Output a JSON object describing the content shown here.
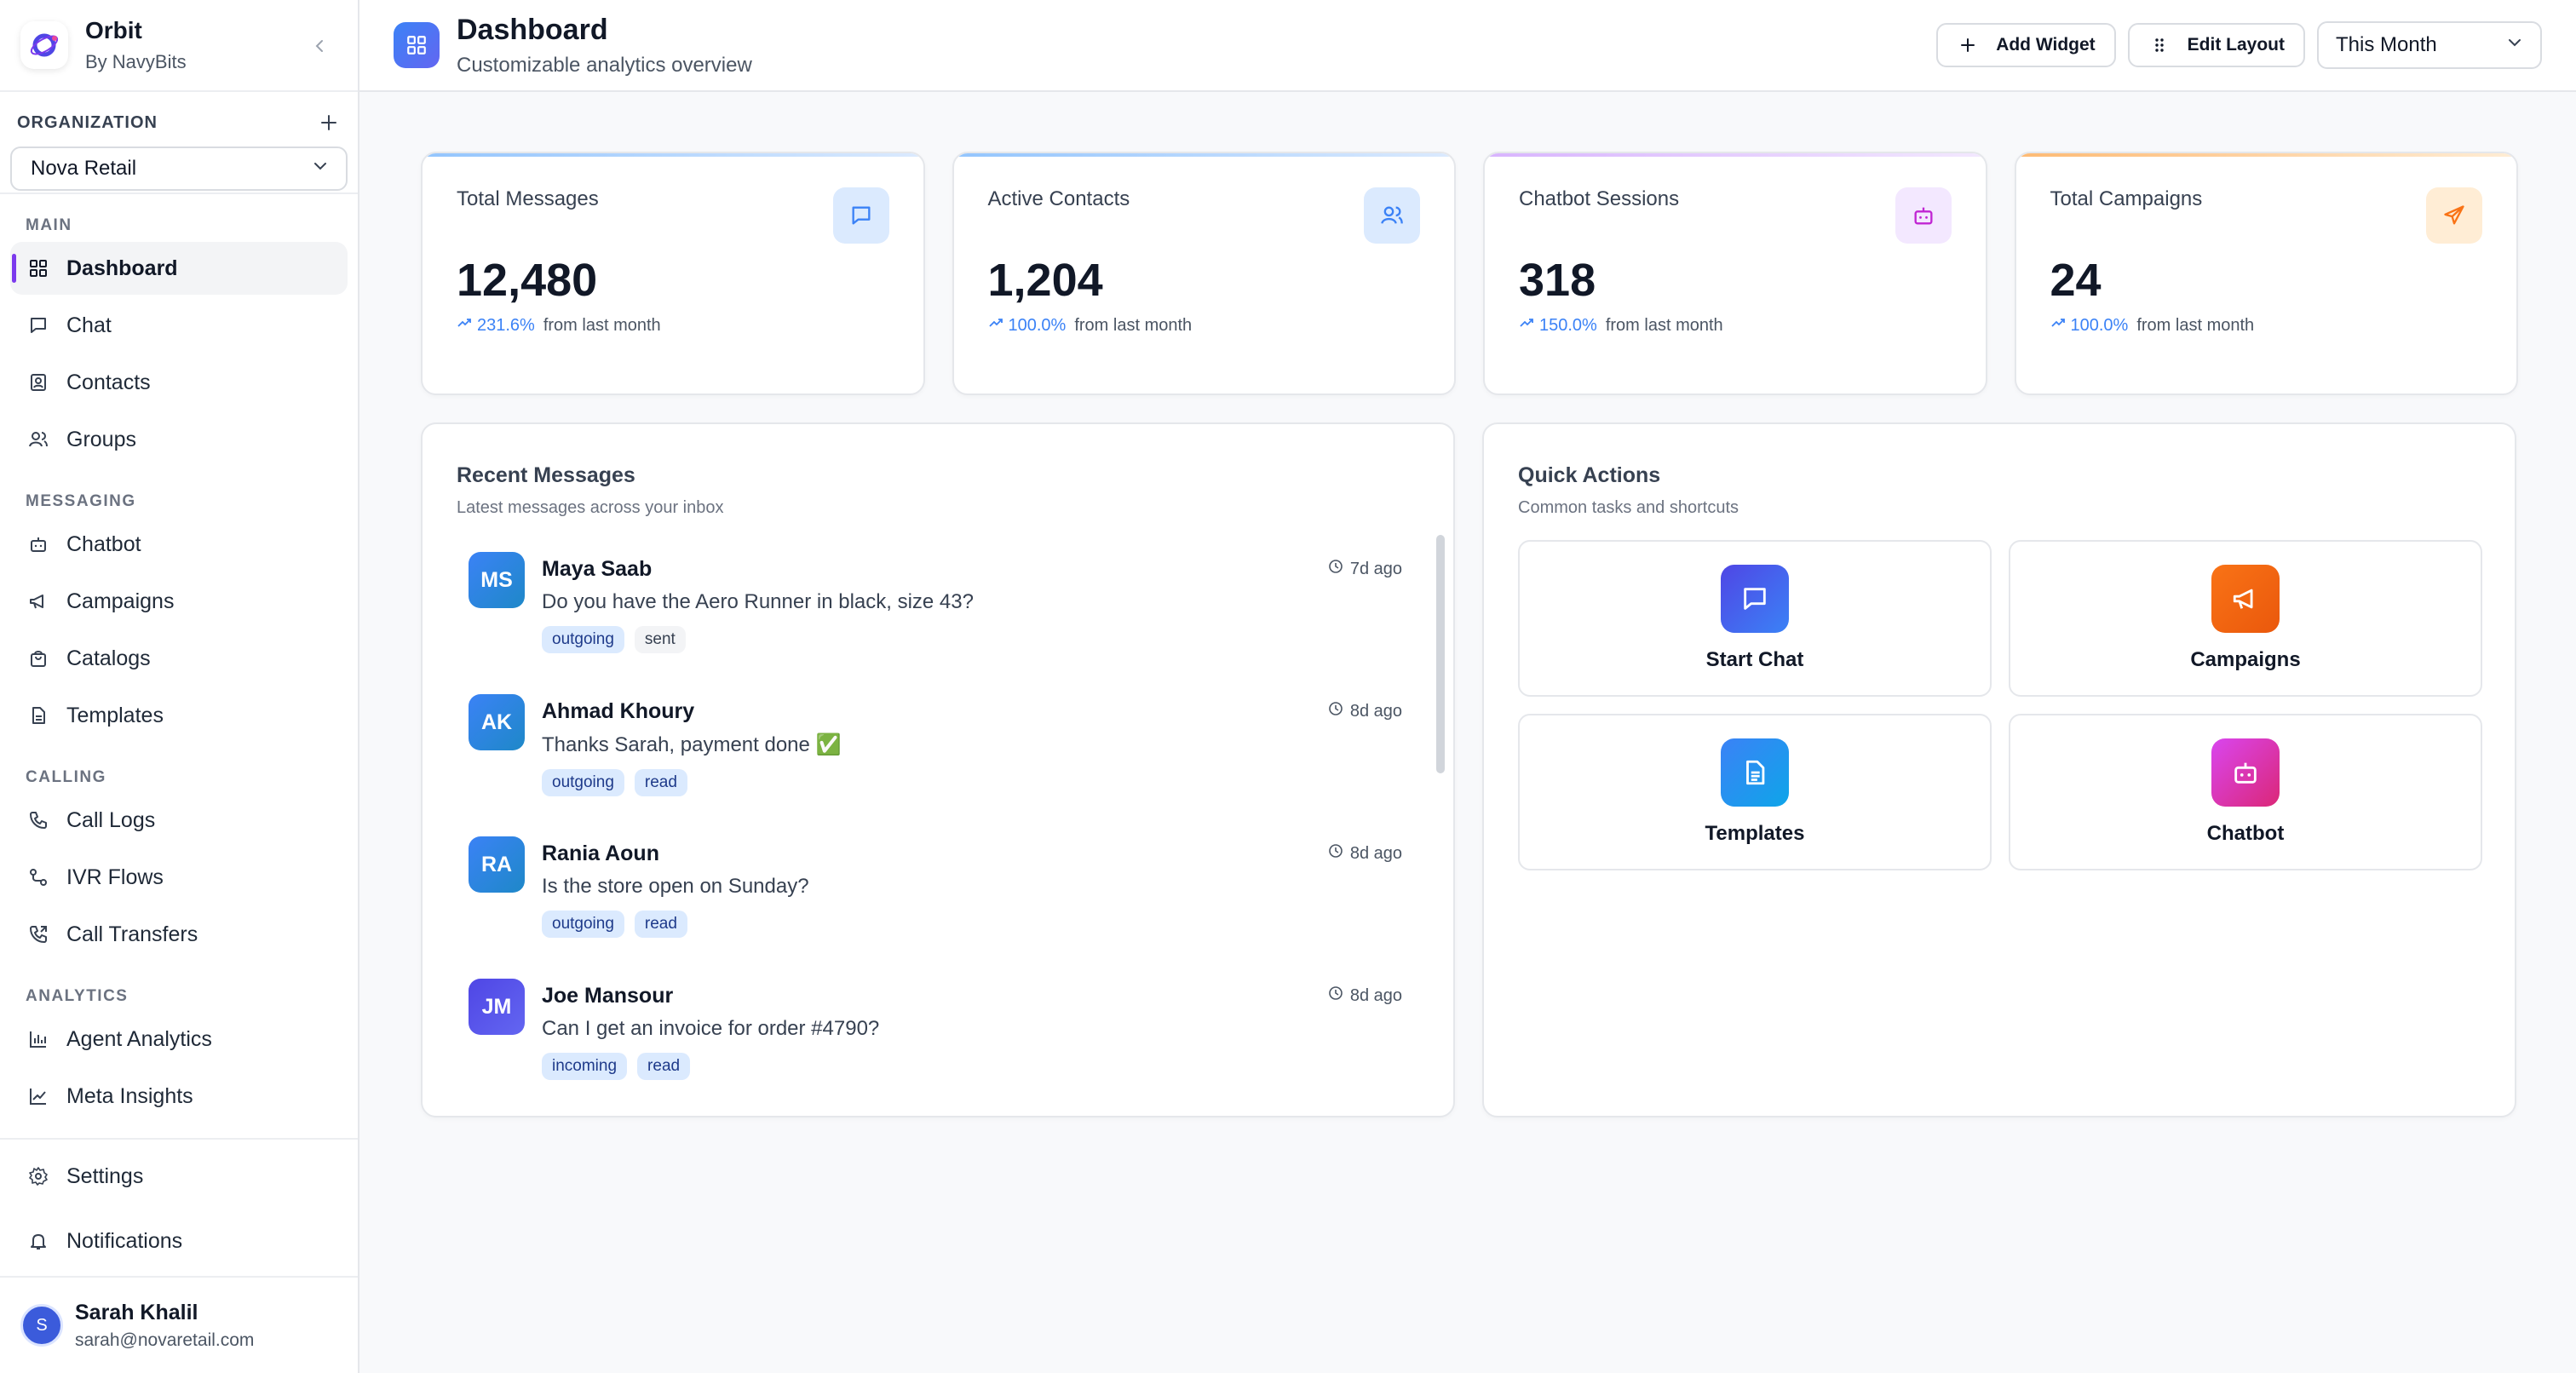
{
  "brand": {
    "name": "Orbit",
    "sub": "By NavyBits"
  },
  "organization": {
    "label": "ORGANIZATION",
    "selected": "Nova Retail"
  },
  "nav": {
    "main_label": "MAIN",
    "dashboard": "Dashboard",
    "chat": "Chat",
    "contacts": "Contacts",
    "groups": "Groups",
    "messaging_label": "MESSAGING",
    "chatbot": "Chatbot",
    "campaigns": "Campaigns",
    "catalogs": "Catalogs",
    "templates": "Templates",
    "calling_label": "CALLING",
    "call_logs": "Call Logs",
    "ivr_flows": "IVR Flows",
    "call_transfers": "Call Transfers",
    "analytics_label": "ANALYTICS",
    "agent_analytics": "Agent Analytics",
    "meta_insights": "Meta Insights",
    "settings": "Settings",
    "notifications": "Notifications"
  },
  "user": {
    "initial": "S",
    "name": "Sarah Khalil",
    "email": "sarah@novaretail.com"
  },
  "header": {
    "title": "Dashboard",
    "subtitle": "Customizable analytics overview",
    "add_widget": "Add Widget",
    "edit_layout": "Edit Layout",
    "period": "This Month"
  },
  "stats": [
    {
      "label": "Total Messages",
      "value": "12,480",
      "pct": "231.6%",
      "suffix": "from last month"
    },
    {
      "label": "Active Contacts",
      "value": "1,204",
      "pct": "100.0%",
      "suffix": "from last month"
    },
    {
      "label": "Chatbot Sessions",
      "value": "318",
      "pct": "150.0%",
      "suffix": "from last month"
    },
    {
      "label": "Total Campaigns",
      "value": "24",
      "pct": "100.0%",
      "suffix": "from last month"
    }
  ],
  "recent": {
    "title": "Recent Messages",
    "subtitle": "Latest messages across your inbox",
    "items": [
      {
        "initials": "MS",
        "name": "Maya Saab",
        "text": "Do you have the Aero Runner in black, size 43?",
        "dir": "outgoing",
        "status": "sent",
        "time": "7d ago"
      },
      {
        "initials": "AK",
        "name": "Ahmad Khoury",
        "text": "Thanks Sarah, payment done ✅",
        "dir": "outgoing",
        "status": "read",
        "time": "8d ago"
      },
      {
        "initials": "RA",
        "name": "Rania Aoun",
        "text": "Is the store open on Sunday?",
        "dir": "outgoing",
        "status": "read",
        "time": "8d ago"
      },
      {
        "initials": "JM",
        "name": "Joe Mansour",
        "text": "Can I get an invoice for order #4790?",
        "dir": "incoming",
        "status": "read",
        "time": "8d ago"
      }
    ]
  },
  "quick": {
    "title": "Quick Actions",
    "subtitle": "Common tasks and shortcuts",
    "start_chat": "Start Chat",
    "campaigns": "Campaigns",
    "templates": "Templates",
    "chatbot": "Chatbot"
  },
  "colors": {
    "accent": "#7c3aed",
    "blue": "#3b82f6",
    "orange": "#f97316",
    "pink": "#d946ef"
  }
}
